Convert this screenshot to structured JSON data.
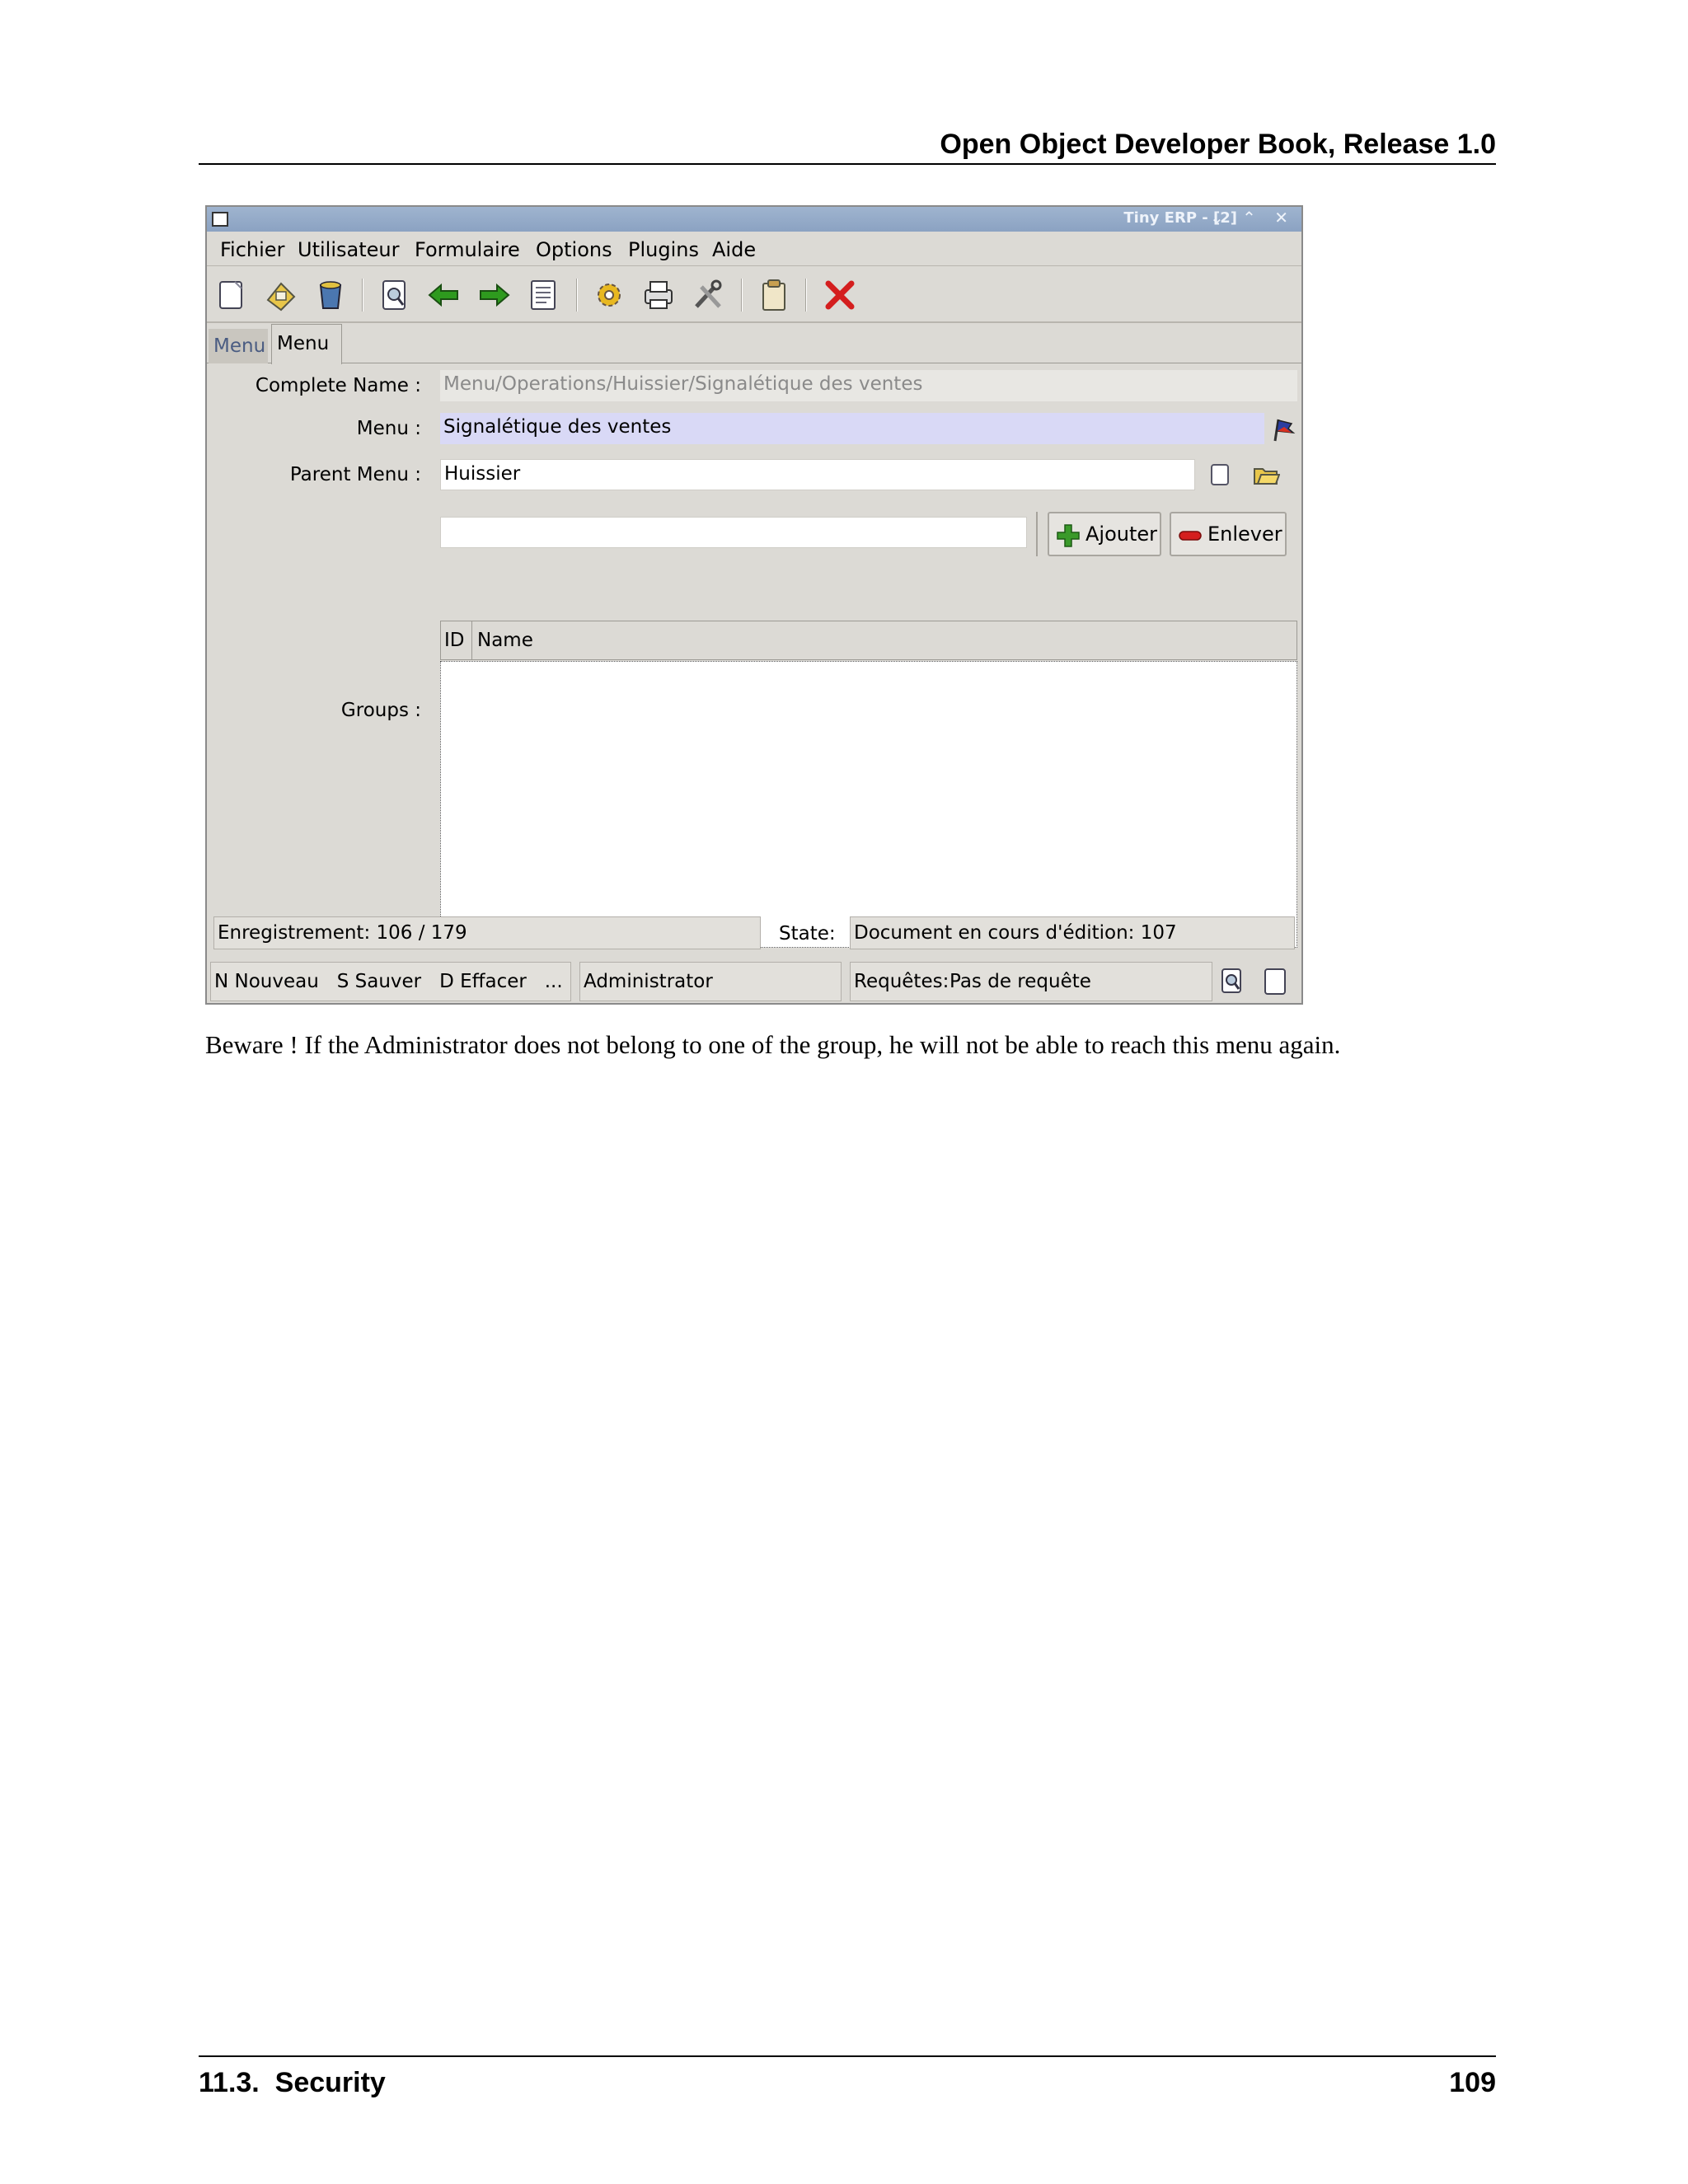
{
  "page": {
    "header_title": "Open Object Developer Book, Release 1.0",
    "footer_section": "11.3.  Security",
    "footer_page": "109",
    "caption": "Beware ! If the Administrator does not belong to one of the group, he will not be able to reach this menu again."
  },
  "window": {
    "title": "Tiny ERP - [2]",
    "controls": "⌄ ⌃ ✕"
  },
  "menubar": {
    "items": [
      "Fichier",
      "Utilisateur",
      "Formulaire",
      "Options",
      "Plugins",
      "Aide"
    ]
  },
  "toolbar": {
    "icons": [
      "new-icon",
      "save-icon",
      "delete-icon",
      "search-icon",
      "previous-icon",
      "next-icon",
      "list-icon",
      "action-icon",
      "print-icon",
      "tools-icon",
      "attachment-icon",
      "close-icon"
    ]
  },
  "tabs": {
    "first": "Menu",
    "second": "Menu"
  },
  "form": {
    "complete_name_label": "Complete Name :",
    "complete_name_value": "Menu/Operations/Huissier/Signalétique des ventes",
    "menu_label": "Menu :",
    "menu_value": "Signalétique des ventes",
    "parent_menu_label": "Parent Menu :",
    "parent_menu_value": "Huissier",
    "groups_label": "Groups :",
    "groups_search_value": "",
    "add_button": "Ajouter",
    "remove_button": "Enlever",
    "groups_columns": [
      "ID",
      "Name"
    ],
    "groups_rows": []
  },
  "status": {
    "record": "Enregistrement: 106 / 179",
    "state_label": "State:",
    "state_value": "Document en cours d'édition: 107",
    "shortcuts": "N Nouveau   S Sauver   D Effacer   ...",
    "user": "Administrator",
    "requests_label": "Requêtes:",
    "requests_value": "Pas de requête"
  },
  "colors": {
    "titlebar": "#8ba2c2",
    "window_bg": "#dcdad5",
    "highlight_field": "#d9d9f6",
    "add_green": "#3a9a2a",
    "remove_red": "#d41e1e"
  }
}
